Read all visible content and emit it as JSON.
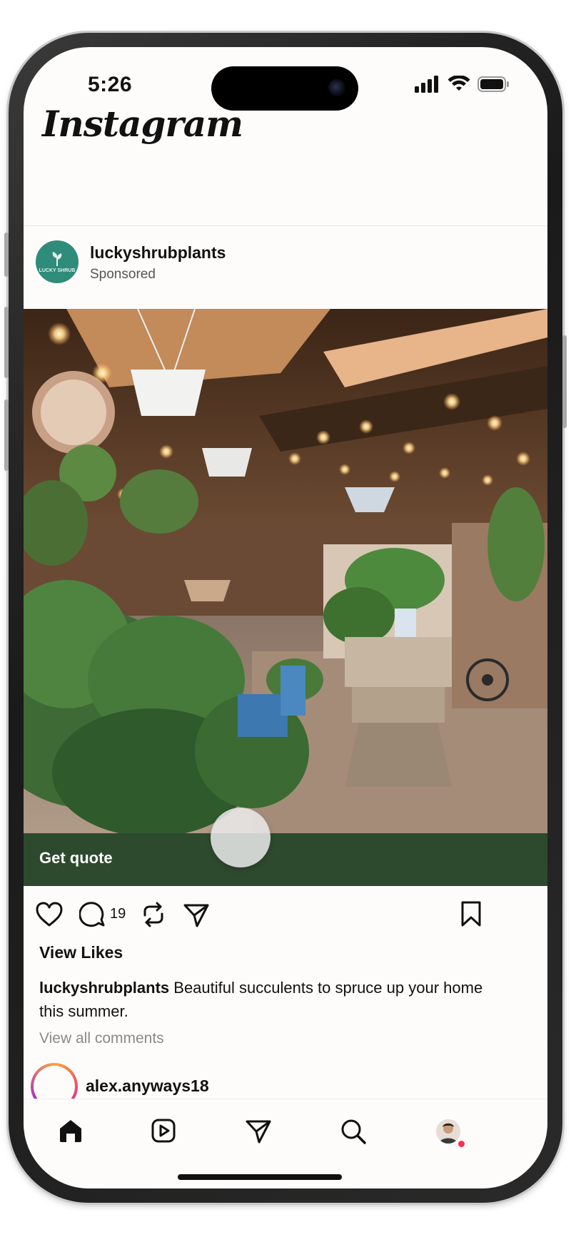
{
  "status_bar": {
    "time": "5:26"
  },
  "app": {
    "title": "Instagram"
  },
  "post": {
    "username": "luckyshrubplants",
    "label": "Sponsored",
    "avatar_text": "LUCKY SHRUB",
    "cta_label": "Get quote",
    "comment_count": "19",
    "likes_label": "View Likes",
    "caption_user": "luckyshrubplants",
    "caption_text": " Beautiful succulents to spruce up your home this summer.",
    "view_comments": "View all comments"
  },
  "next_post": {
    "username": "alex.anyways18"
  },
  "colors": {
    "cta_bg": "#2e4a2e",
    "avatar_bg": "#2f8b7a",
    "notif": "#ff2d55"
  },
  "tabbar": {
    "items": [
      "home-icon",
      "reels-icon",
      "send-icon",
      "search-icon",
      "profile-avatar"
    ]
  }
}
